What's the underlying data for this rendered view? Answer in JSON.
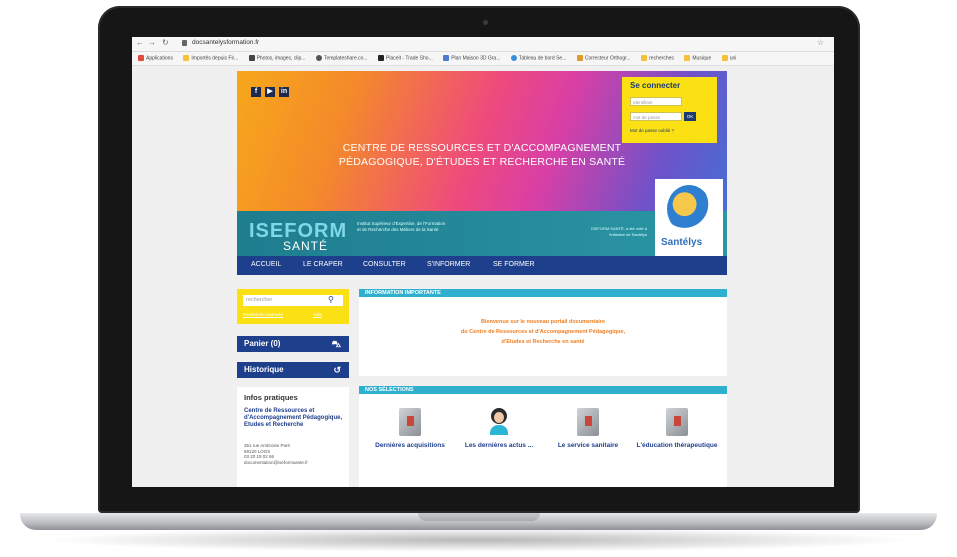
{
  "browser": {
    "url": "docsantelysformation.fr",
    "bookmarks": [
      "Applications",
      "Importés depuis Fir...",
      "Photos, images, clip...",
      "Templateshare.co...",
      "Placeit - Trade Sho...",
      "Plan Maison 3D Gra...",
      "Tableau de bord Se...",
      "Correcteur Orthogr...",
      "recherches",
      "Musique",
      "uni"
    ]
  },
  "header": {
    "social": [
      "f",
      "▶",
      "in"
    ],
    "title_line1": "CENTRE DE RESSOURCES ET D'ACCOMPAGNEMENT",
    "title_line2": "PÉDAGOGIQUE, D'ÉTUDES ET RECHERCHE EN SANTÉ",
    "iseform": "ISEFORM",
    "iseform_sub": "SANTÉ",
    "iseform_desc": "Institut Supérieur d'Expertise, de l'Formation et de Recherche des Métiers de la Santé",
    "partner_text": "ISEFORM SANTÉ, a été créé à l'initiative de Santélys",
    "santelys": "Santélys"
  },
  "login": {
    "title": "Se connecter",
    "user_placeholder": "Identifiant",
    "pass_placeholder": "mot de passe",
    "ok": "OK",
    "forgot": "Mot de passe oublié ?"
  },
  "menu": [
    "ACCUEIL",
    "LE CRAPER",
    "CONSULTER",
    "S'INFORMER",
    "SE FORMER"
  ],
  "sidebar": {
    "search_placeholder": "rechercher",
    "advanced": "Recherche avancée",
    "help": "Aide",
    "cart": "Panier (0)",
    "history": "Historique",
    "infos_title": "Infos pratiques",
    "org": "Centre de Ressources et d'Accompagnement Pédagogique, Etudes et Recherche",
    "addr1": "351 rue Ambroise Paré",
    "addr2": "59120 LOOS",
    "phone": "03 20 19 02 66",
    "email": "documentation@iseformsante.fr"
  },
  "info": {
    "head": "INFORMATION IMPORTANTE",
    "line1": "Bienvenue sur le nouveau portail documentaire",
    "line2": "du Centre de Ressources et d'Accompagnement Pédagogique,",
    "line3": "d'Etudes et Recherche en santé"
  },
  "selections": {
    "head": "NOS SÉLECTIONS",
    "items": [
      "Dernières acquisitions",
      "Les dernières actus ...",
      "Le service sanitaire",
      "L'éducation thérapeutique"
    ]
  }
}
